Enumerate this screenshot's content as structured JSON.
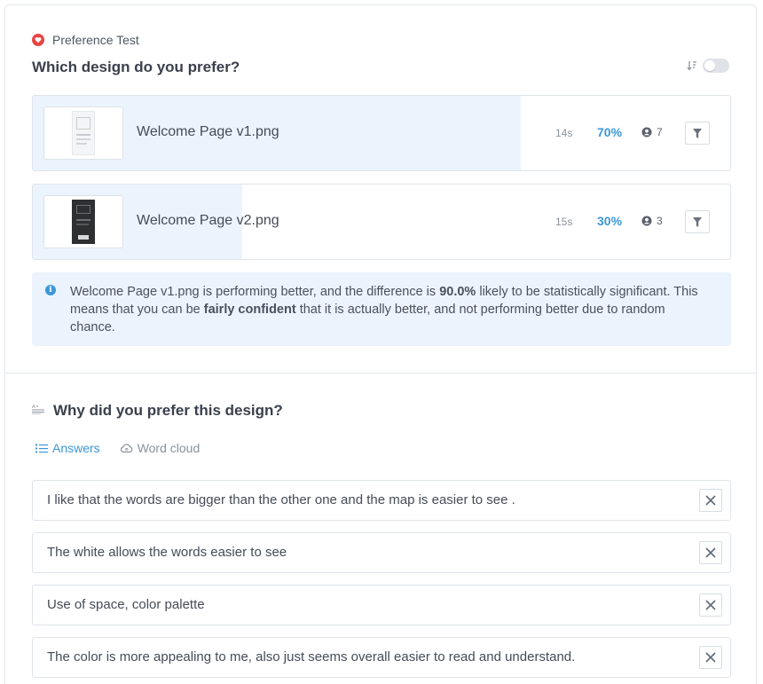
{
  "test": {
    "type_label": "Preference Test",
    "question": "Which design do you prefer?",
    "colors": {
      "accent": "#3d97d8",
      "fill": "#ebf4fd",
      "heart": "#e84545"
    }
  },
  "designs": [
    {
      "name": "Welcome Page v1.png",
      "time": "14s",
      "percent": "70%",
      "share": 0.7,
      "voters": "7",
      "thumbnail": "light-page-thumbnail"
    },
    {
      "name": "Welcome Page v2.png",
      "time": "15s",
      "percent": "30%",
      "share": 0.3,
      "voters": "3",
      "thumbnail": "dark-page-thumbnail"
    }
  ],
  "insight": {
    "part1": "Welcome Page v1.png is performing better, and the difference is ",
    "highlight1": "90.0%",
    "part2": " likely to be statistically significant. This means that you can be ",
    "highlight2": "fairly confident",
    "part3": " that it is actually better, and not performing better due to random chance."
  },
  "followup": {
    "question": "Why did you prefer this design?",
    "tabs": [
      {
        "label": "Answers",
        "icon": "list-icon",
        "active": true
      },
      {
        "label": "Word cloud",
        "icon": "cloud-icon",
        "active": false
      }
    ],
    "answers": [
      "I like that the words are bigger than the other one and the map is easier to see .",
      "The white allows the words easier to see",
      "Use of space, color palette",
      "The color is more appealing to me, also just seems overall easier to read and understand."
    ]
  }
}
